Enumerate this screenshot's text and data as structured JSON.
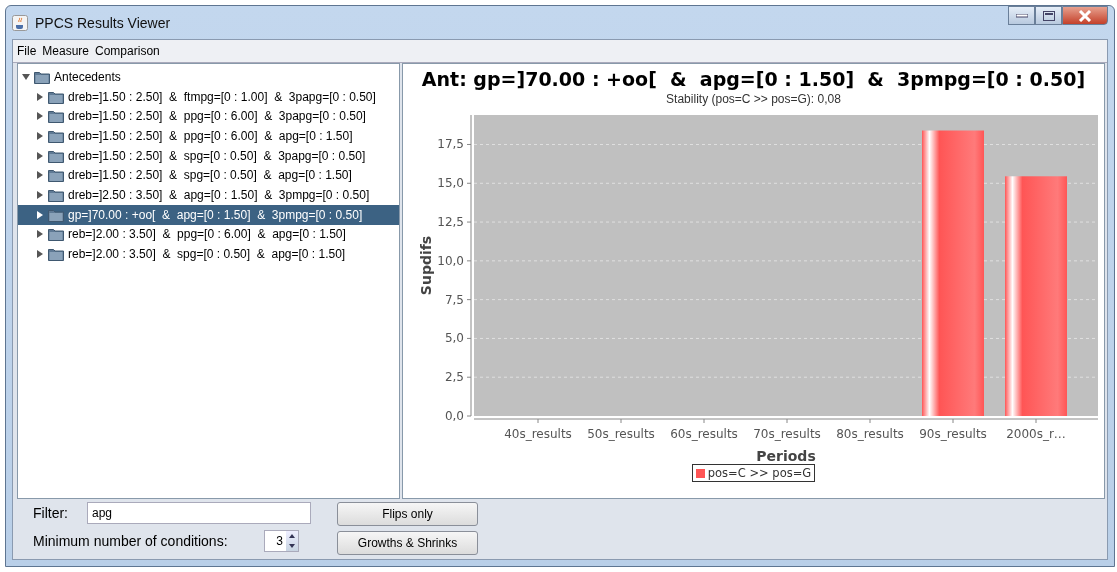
{
  "window": {
    "title": "PPCS Results Viewer"
  },
  "menu": [
    "File",
    "Measure",
    "Comparison"
  ],
  "tree": {
    "label": "Antecedents",
    "expanded": true,
    "selected": false,
    "children": [
      {
        "label": "dreb=]1.50 : 2.50]  &  ftmpg=[0 : 1.00]  &  3papg=[0 : 0.50]",
        "expanded": false,
        "selected": false
      },
      {
        "label": "dreb=]1.50 : 2.50]  &  ppg=[0 : 6.00]  &  3papg=[0 : 0.50]",
        "expanded": false,
        "selected": false
      },
      {
        "label": "dreb=]1.50 : 2.50]  &  ppg=[0 : 6.00]  &  apg=[0 : 1.50]",
        "expanded": false,
        "selected": false
      },
      {
        "label": "dreb=]1.50 : 2.50]  &  spg=[0 : 0.50]  &  3papg=[0 : 0.50]",
        "expanded": false,
        "selected": false
      },
      {
        "label": "dreb=]1.50 : 2.50]  &  spg=[0 : 0.50]  &  apg=[0 : 1.50]",
        "expanded": false,
        "selected": false
      },
      {
        "label": "dreb=]2.50 : 3.50]  &  apg=[0 : 1.50]  &  3pmpg=[0 : 0.50]",
        "expanded": false,
        "selected": false
      },
      {
        "label": "gp=]70.00 : +oo[  &  apg=[0 : 1.50]  &  3pmpg=[0 : 0.50]",
        "expanded": false,
        "selected": true
      },
      {
        "label": "reb=]2.00 : 3.50]  &  ppg=[0 : 6.00]  &  apg=[0 : 1.50]",
        "expanded": false,
        "selected": false
      },
      {
        "label": "reb=]2.00 : 3.50]  &  spg=[0 : 0.50]  &  apg=[0 : 1.50]",
        "expanded": false,
        "selected": false
      }
    ]
  },
  "chart": {
    "title": "Ant: gp=]70.00 : +oo[  &  apg=[0 : 1.50]  &  3pmpg=[0 : 0.50]",
    "subtitle": "Stability (pos=C >> pos=G): 0,08",
    "chart_data": {
      "type": "bar",
      "xlabel": "Periods",
      "ylabel": "Supdifs",
      "categories": [
        "40s_results",
        "50s_results",
        "60s_results",
        "70s_results",
        "80s_results",
        "90s_results",
        "2000s_r…"
      ],
      "series": [
        {
          "name": "pos=C >> pos=G",
          "color": "#ff5555",
          "values": [
            0,
            0,
            0,
            0,
            0,
            18.4,
            15.45
          ]
        }
      ],
      "ylim": [
        0,
        19.4
      ],
      "grid": true,
      "yticks": [
        {
          "value": 0,
          "label": "0,0"
        },
        {
          "value": 2.5,
          "label": "2,5"
        },
        {
          "value": 5,
          "label": "5,0"
        },
        {
          "value": 7.5,
          "label": "7,5"
        },
        {
          "value": 10,
          "label": "10,0"
        },
        {
          "value": 12.5,
          "label": "12,5"
        },
        {
          "value": 15,
          "label": "15,0"
        },
        {
          "value": 17.5,
          "label": "17,5"
        }
      ]
    }
  },
  "filter": {
    "label": "Filter:",
    "value": "apg"
  },
  "min_conditions": {
    "label": "Minimum number of conditions:",
    "value": "3"
  },
  "buttons": [
    "Flips only",
    "Growths & Shrinks"
  ]
}
